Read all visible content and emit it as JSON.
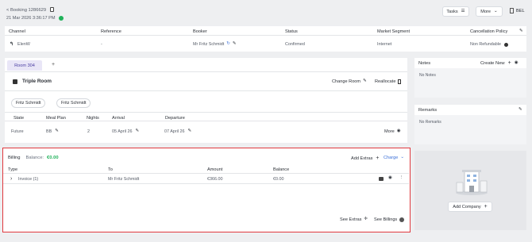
{
  "header": {
    "back_label": "< Booking 1286629",
    "datetime": "21 Mar 2026 3:36:17 PM",
    "tasks_label": "Tasks",
    "more_label": "More",
    "lang_label": "BEL"
  },
  "summary": {
    "columns": [
      "Channel",
      "Reference",
      "Booker",
      "Status",
      "Market Segment",
      "Cancellation Policy"
    ],
    "channel": "ElenW",
    "reference": "-",
    "booker": "Mr Fritz Schmidt",
    "status": "Confirmed",
    "market_segment": "Internet",
    "cancellation_policy": "Non Refundable"
  },
  "room": {
    "tab_label": "Room 304",
    "add_tab": "+",
    "room_type": "Triple Room",
    "change_room_label": "Change Room",
    "reallocate_label": "Reallocate",
    "guests": [
      "Fritz Schmidt",
      "Fritz Schmidt"
    ],
    "columns": [
      "State",
      "Meal Plan",
      "Nights",
      "Arrival",
      "Departure"
    ],
    "state": "Future",
    "meal_plan": "BB",
    "nights": "2",
    "arrival": "05 April 26",
    "departure": "07 April 26",
    "more_label": "More"
  },
  "billing": {
    "title": "Billing",
    "balance_label": "Balance:",
    "balance_value": "€0.00",
    "add_extras_label": "Add Extras",
    "charge_label": "Charge",
    "columns": [
      "Type",
      "To",
      "Amount",
      "Balance"
    ],
    "invoice_type": "Invoice (1)",
    "invoice_to": "Mr Fritz Schmidt",
    "invoice_amount": "€366.00",
    "invoice_balance": "€0.00",
    "see_extras_label": "See Extras",
    "see_billings_label": "See Billings"
  },
  "notes": {
    "title": "Notes",
    "create_label": "Create New",
    "empty": "No Notes"
  },
  "remarks": {
    "title": "Remarks",
    "empty": "No Remarks"
  },
  "company": {
    "add_label": "Add Company"
  },
  "colors": {
    "accent_green": "#20b25a",
    "link_blue": "#3a6fd8",
    "highlight_red": "#e0393e",
    "tab_purple": "#e9e6f7"
  }
}
